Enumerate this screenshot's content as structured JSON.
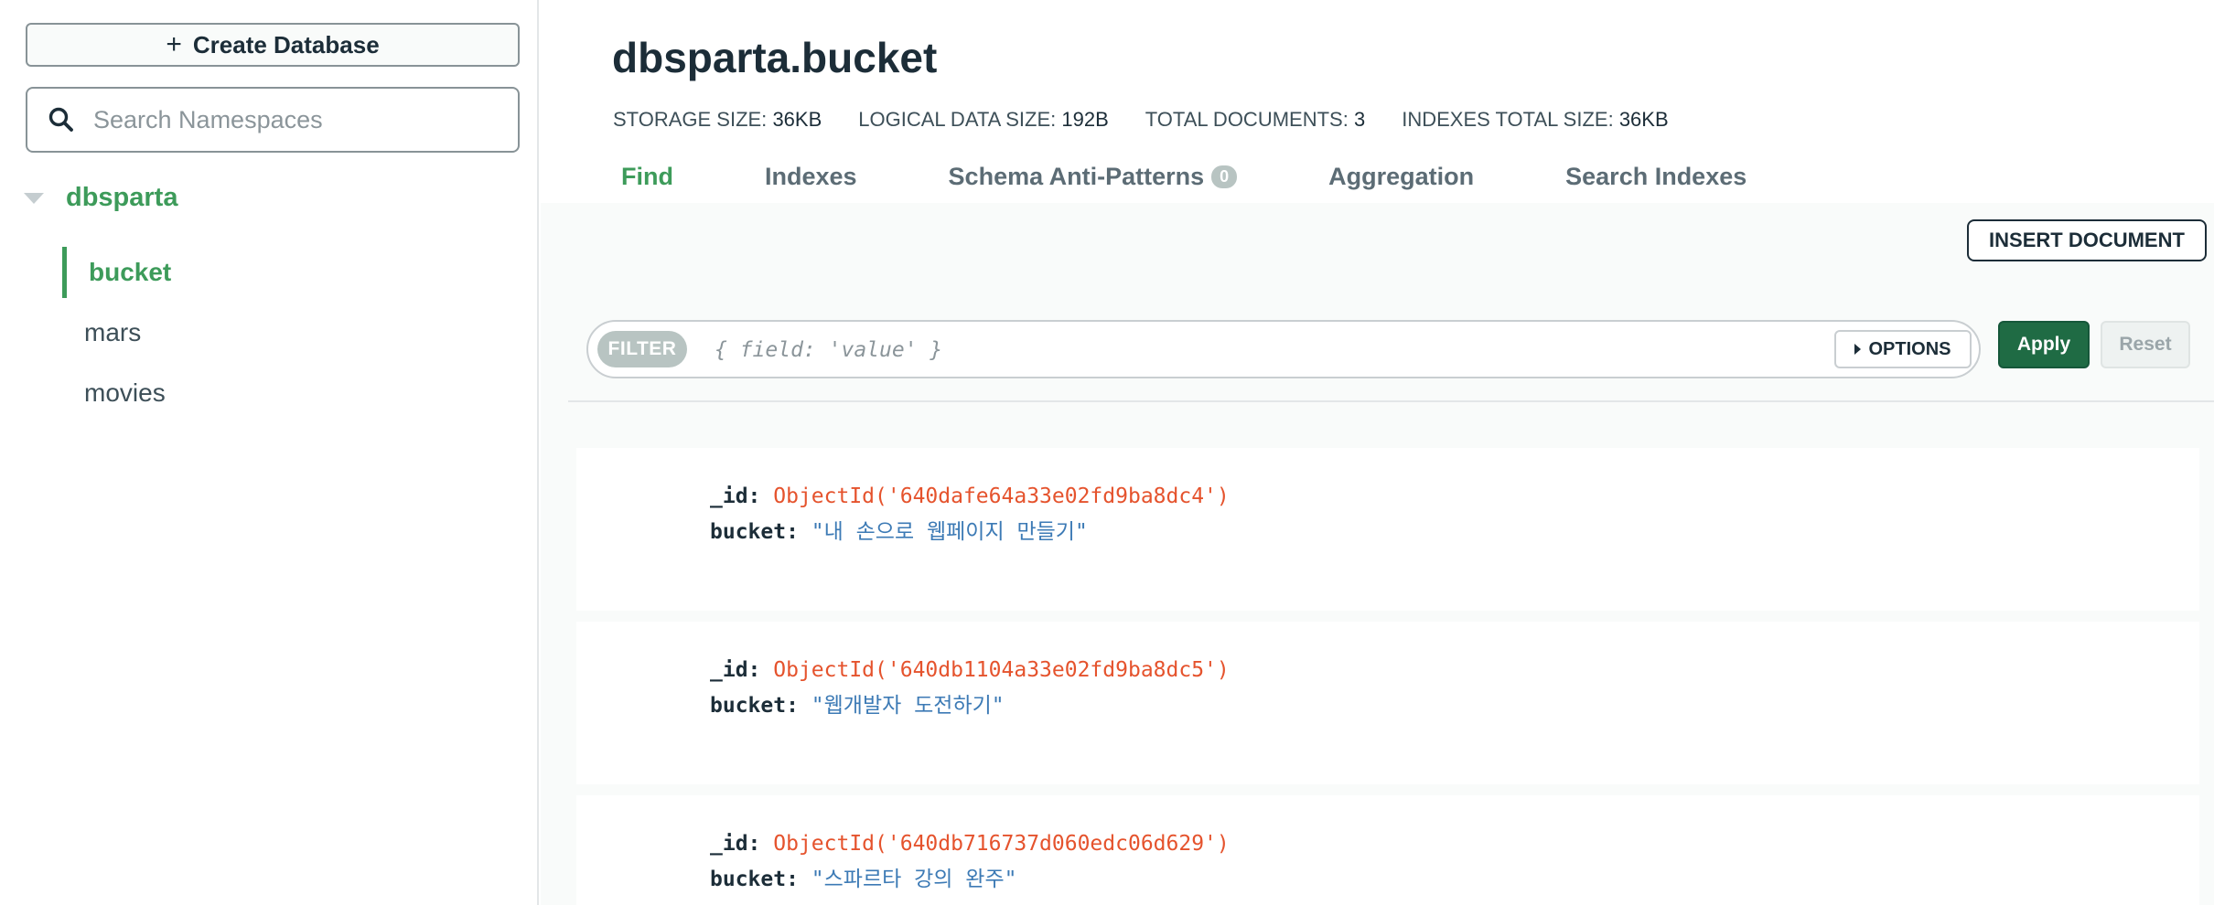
{
  "sidebar": {
    "create_database_label": "Create Database",
    "create_database_icon": "plus-icon",
    "search_placeholder": "Search Namespaces",
    "database_name": "dbsparta",
    "collections": [
      "bucket",
      "mars",
      "movies"
    ],
    "active_collection": "bucket"
  },
  "header": {
    "title": "dbsparta.bucket",
    "stats": [
      {
        "label": "STORAGE SIZE:",
        "value": "36KB"
      },
      {
        "label": "LOGICAL DATA SIZE:",
        "value": "192B"
      },
      {
        "label": "TOTAL DOCUMENTS:",
        "value": "3"
      },
      {
        "label": "INDEXES TOTAL SIZE:",
        "value": "36KB"
      }
    ],
    "tabs": [
      {
        "label": "Find",
        "active": true
      },
      {
        "label": "Indexes",
        "active": false
      },
      {
        "label": "Schema Anti-Patterns",
        "badge": "0",
        "active": false
      },
      {
        "label": "Aggregation",
        "active": false
      },
      {
        "label": "Search Indexes",
        "active": false
      }
    ]
  },
  "toolbar": {
    "insert_document_label": "INSERT DOCUMENT",
    "filter_pill": "FILTER",
    "filter_placeholder": "{ field: 'value' }",
    "options_label": "OPTIONS",
    "apply_label": "Apply",
    "reset_label": "Reset"
  },
  "documents": [
    {
      "id_key": "_id:",
      "id_value": "ObjectId('640dafe64a33e02fd9ba8dc4')",
      "field_key": "bucket:",
      "field_value": "\"내 손으로 웹페이지 만들기\""
    },
    {
      "id_key": "_id:",
      "id_value": "ObjectId('640db1104a33e02fd9ba8dc5')",
      "field_key": "bucket:",
      "field_value": "\"웹개발자 도전하기\""
    },
    {
      "id_key": "_id:",
      "id_value": "ObjectId('640db716737d060edc06d629')",
      "field_key": "bucket:",
      "field_value": "\"스파르타 강의 완주\""
    }
  ],
  "colors": {
    "accent_green": "#3d9b5a",
    "apply_green": "#1f6b44",
    "objectid_red": "#e5532d",
    "string_blue": "#3c7ab5"
  }
}
